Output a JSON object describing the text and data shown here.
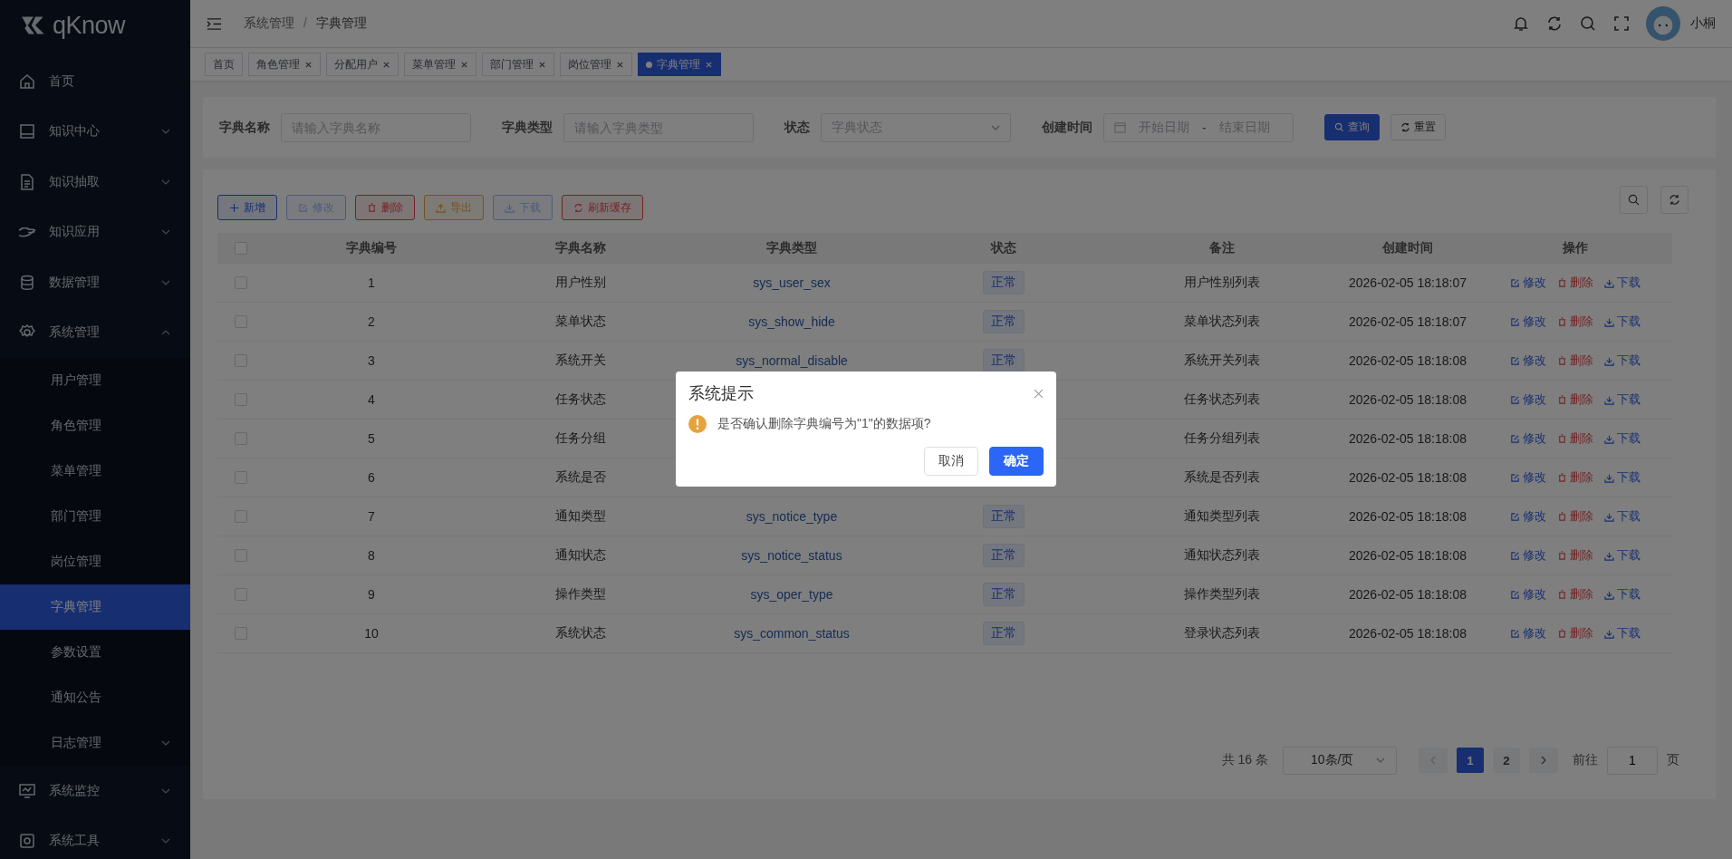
{
  "sidebar": {
    "logo": "qKnow",
    "items": [
      {
        "label": "首页"
      },
      {
        "label": "知识中心",
        "expanded": false
      },
      {
        "label": "知识抽取",
        "expanded": false
      },
      {
        "label": "知识应用",
        "expanded": false
      },
      {
        "label": "数据管理",
        "expanded": false
      },
      {
        "label": "系统管理",
        "expanded": true,
        "children": [
          {
            "label": "用户管理",
            "selected": false
          },
          {
            "label": "角色管理",
            "selected": false
          },
          {
            "label": "菜单管理",
            "selected": false
          },
          {
            "label": "部门管理",
            "selected": false
          },
          {
            "label": "岗位管理",
            "selected": false
          },
          {
            "label": "字典管理",
            "selected": true
          },
          {
            "label": "参数设置",
            "selected": false
          },
          {
            "label": "通知公告",
            "selected": false
          },
          {
            "label": "日志管理",
            "selected": false,
            "expanded": false
          }
        ]
      },
      {
        "label": "系统监控",
        "expanded": false
      },
      {
        "label": "系统工具",
        "expanded": false
      }
    ]
  },
  "header": {
    "breadcrumb": [
      "系统管理",
      "字典管理"
    ],
    "breadcrumb_separator": "/",
    "user_name": "小桐"
  },
  "tabs": [
    {
      "label": "首页",
      "selected": false,
      "closable": false
    },
    {
      "label": "角色管理",
      "selected": false,
      "closable": true
    },
    {
      "label": "分配用户",
      "selected": false,
      "closable": true
    },
    {
      "label": "菜单管理",
      "selected": false,
      "closable": true
    },
    {
      "label": "部门管理",
      "selected": false,
      "closable": true
    },
    {
      "label": "岗位管理",
      "selected": false,
      "closable": true
    },
    {
      "label": "字典管理",
      "selected": true,
      "closable": true
    }
  ],
  "filters": [
    {
      "kind": "text",
      "label": "字典名称",
      "placeholder": "请输入字典名称"
    },
    {
      "kind": "text",
      "label": "字典类型",
      "placeholder": "请输入字典类型"
    },
    {
      "kind": "select",
      "label": "状态",
      "placeholder": "字典状态"
    },
    {
      "kind": "daterange",
      "label": "创建时间",
      "start_placeholder": "开始日期",
      "separator": "-",
      "end_placeholder": "结束日期"
    }
  ],
  "filter_buttons": [
    {
      "label": "查询",
      "primary": true
    },
    {
      "label": "重置",
      "primary": false
    }
  ],
  "toolbar": [
    {
      "kind": "primary",
      "label": "新增",
      "disabled": false
    },
    {
      "kind": "primary",
      "label": "修改",
      "disabled": true
    },
    {
      "kind": "danger",
      "label": "删除",
      "disabled": false
    },
    {
      "kind": "warning",
      "label": "导出",
      "disabled": false
    },
    {
      "kind": "primary",
      "label": "下载",
      "disabled": true
    },
    {
      "kind": "danger",
      "label": "刷新缓存",
      "disabled": false
    }
  ],
  "table": {
    "all_checked": false,
    "columns": [
      "字典编号",
      "字典名称",
      "字典类型",
      "状态",
      "备注",
      "创建时间",
      "操作"
    ],
    "rows": [
      {
        "checked": false,
        "id": "1",
        "name": "用户性别",
        "type": "sys_user_sex",
        "status": "正常",
        "remark": "用户性别列表",
        "created": "2026-02-05 18:18:07",
        "actions": [
          "修改",
          "删除",
          "下载"
        ]
      },
      {
        "checked": false,
        "id": "2",
        "name": "菜单状态",
        "type": "sys_show_hide",
        "status": "正常",
        "remark": "菜单状态列表",
        "created": "2026-02-05 18:18:07",
        "actions": [
          "修改",
          "删除",
          "下载"
        ]
      },
      {
        "checked": false,
        "id": "3",
        "name": "系统开关",
        "type": "sys_normal_disable",
        "status": "正常",
        "remark": "系统开关列表",
        "created": "2026-02-05 18:18:08",
        "actions": [
          "修改",
          "删除",
          "下载"
        ]
      },
      {
        "checked": false,
        "id": "4",
        "name": "任务状态",
        "remark": "任务状态列表",
        "created": "2026-02-05 18:18:08",
        "actions": [
          "修改",
          "删除",
          "下载"
        ]
      },
      {
        "checked": false,
        "id": "5",
        "name": "任务分组",
        "remark": "任务分组列表",
        "created": "2026-02-05 18:18:08",
        "actions": [
          "修改",
          "删除",
          "下载"
        ]
      },
      {
        "checked": false,
        "id": "6",
        "name": "系统是否",
        "remark": "系统是否列表",
        "created": "2026-02-05 18:18:08",
        "actions": [
          "修改",
          "删除",
          "下载"
        ]
      },
      {
        "checked": false,
        "id": "7",
        "name": "通知类型",
        "type": "sys_notice_type",
        "status": "正常",
        "remark": "通知类型列表",
        "created": "2026-02-05 18:18:08",
        "actions": [
          "修改",
          "删除",
          "下载"
        ]
      },
      {
        "checked": false,
        "id": "8",
        "name": "通知状态",
        "type": "sys_notice_status",
        "status": "正常",
        "remark": "通知状态列表",
        "created": "2026-02-05 18:18:08",
        "actions": [
          "修改",
          "删除",
          "下载"
        ]
      },
      {
        "checked": false,
        "id": "9",
        "name": "操作类型",
        "type": "sys_oper_type",
        "status": "正常",
        "remark": "操作类型列表",
        "created": "2026-02-05 18:18:08",
        "actions": [
          "修改",
          "删除",
          "下载"
        ]
      },
      {
        "checked": false,
        "id": "10",
        "name": "系统状态",
        "type": "sys_common_status",
        "status": "正常",
        "remark": "登录状态列表",
        "created": "2026-02-05 18:18:08",
        "actions": [
          "修改",
          "删除",
          "下载"
        ]
      }
    ]
  },
  "pagination": {
    "total": "共 16 条",
    "page_size": "10条/页",
    "pages": [
      {
        "label": "1",
        "selected": true
      },
      {
        "label": "2",
        "selected": false
      }
    ],
    "goto_label": "前往",
    "goto_value": "1",
    "goto_suffix": "页"
  },
  "dialog": {
    "title": "系统提示",
    "message": "是否确认删除字典编号为\"1\"的数据项?",
    "buttons": [
      {
        "label": "取消",
        "primary": false
      },
      {
        "label": "确定",
        "primary": true
      }
    ]
  }
}
